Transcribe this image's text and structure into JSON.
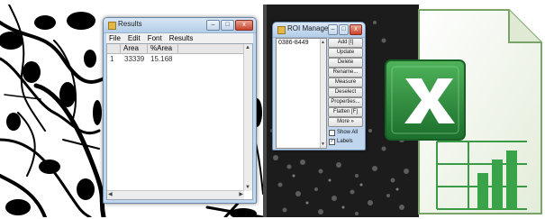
{
  "results_window": {
    "title": "Results",
    "controls": {
      "minimize": "–",
      "maximize": "□",
      "close": "x"
    },
    "menu": [
      "File",
      "Edit",
      "Font",
      "Results"
    ],
    "columns": [
      "Area",
      "%Area"
    ],
    "rows": [
      {
        "index": "1",
        "area": "33339",
        "pct_area": "15.168"
      }
    ]
  },
  "roi_manager": {
    "title": "ROI Manager",
    "controls": {
      "minimize": "–",
      "maximize": "□",
      "close": "x"
    },
    "list_items": [
      "0386-8449"
    ],
    "buttons": [
      "Add [t]",
      "Update",
      "Delete",
      "Rename...",
      "Measure",
      "Deselect",
      "Properties...",
      "Flatten [F]",
      "More »"
    ],
    "show_all_label": "Show All",
    "labels_label": "Labels",
    "labels_checked": "✓"
  },
  "excel_icon": {
    "name": "excel-icon",
    "letter": "X"
  },
  "colors": {
    "excel_green": "#1e7b34",
    "window_frame": "#bfd6ee",
    "close_red": "#c9442b"
  }
}
